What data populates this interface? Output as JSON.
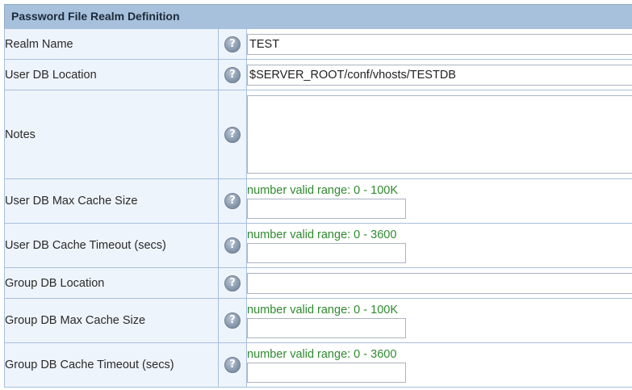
{
  "panel": {
    "title": "Password File Realm Definition"
  },
  "rows": [
    {
      "label": "Realm Name",
      "value": "TEST"
    },
    {
      "label": "User DB Location",
      "value": "$SERVER_ROOT/conf/vhosts/TESTDB"
    },
    {
      "label": "Notes",
      "value": ""
    },
    {
      "label": "User DB Max Cache Size",
      "hint": "number valid range: 0 - 100K",
      "value": ""
    },
    {
      "label": "User DB Cache Timeout (secs)",
      "hint": "number valid range: 0 - 3600",
      "value": ""
    },
    {
      "label": "Group DB Location",
      "value": ""
    },
    {
      "label": "Group DB Max Cache Size",
      "hint": "number valid range: 0 - 100K",
      "value": ""
    },
    {
      "label": "Group DB Cache Timeout (secs)",
      "hint": "number valid range: 0 - 3600",
      "value": ""
    }
  ],
  "icons": {
    "help": "help-icon"
  },
  "colors": {
    "header_bg": "#a7c0dc",
    "label_bg": "#eef4fb",
    "hint_text": "#2f8a2f"
  }
}
